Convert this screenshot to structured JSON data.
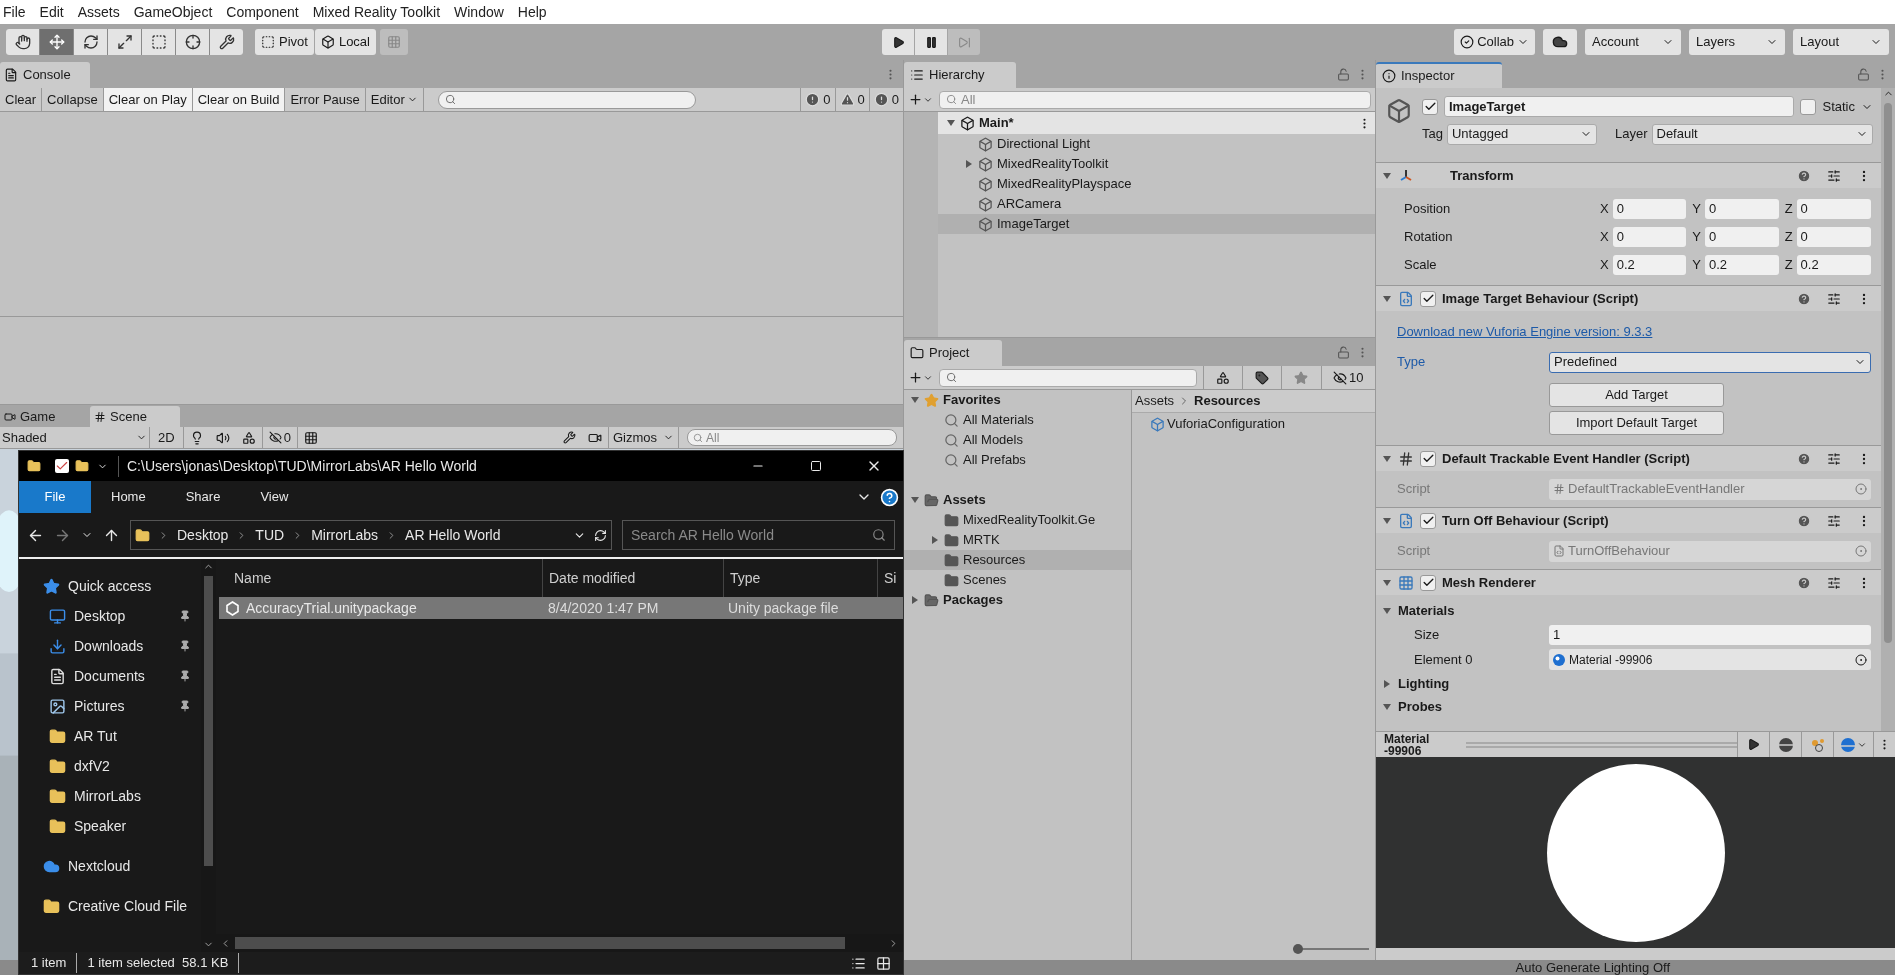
{
  "menu": [
    "File",
    "Edit",
    "Assets",
    "GameObject",
    "Component",
    "Mixed Reality Toolkit",
    "Window",
    "Help"
  ],
  "toolbar": {
    "tools": [
      {
        "selected": false
      },
      {
        "selected": true
      },
      {
        "selected": false
      },
      {
        "selected": false
      },
      {
        "selected": false
      },
      {
        "selected": false
      },
      {
        "selected": false
      }
    ],
    "pivot": "Pivot",
    "local": "Local",
    "collab": "Collab",
    "account": "Account",
    "layers": "Layers",
    "layout": "Layout"
  },
  "console": {
    "tab": "Console",
    "buttons": [
      {
        "label": "Clear",
        "on": false
      },
      {
        "label": "Collapse",
        "on": false
      },
      {
        "label": "Clear on Play",
        "on": true
      },
      {
        "label": "Clear on Build",
        "on": true
      },
      {
        "label": "Error Pause",
        "on": false
      }
    ],
    "editor": "Editor",
    "counts": [
      {
        "kind": "error",
        "count": "0"
      },
      {
        "kind": "warning",
        "count": "0"
      },
      {
        "kind": "info",
        "count": "0"
      }
    ]
  },
  "scene": {
    "tabs": [
      {
        "label": "Game",
        "selected": false
      },
      {
        "label": "Scene",
        "selected": true
      }
    ],
    "shading": "Shaded",
    "mode_2d": "2D",
    "hidden_count": "0",
    "gizmos": "Gizmos",
    "search_placeholder": "All"
  },
  "hierarchy": {
    "tab": "Hierarchy",
    "search_placeholder": "All",
    "scene": "Main*",
    "items": [
      {
        "label": "Directional Light",
        "expandable": false,
        "selected": false
      },
      {
        "label": "MixedRealityToolkit",
        "expandable": true,
        "selected": false
      },
      {
        "label": "MixedRealityPlayspace",
        "expandable": false,
        "selected": false
      },
      {
        "label": "ARCamera",
        "expandable": false,
        "selected": false
      },
      {
        "label": "ImageTarget",
        "expandable": false,
        "selected": true
      }
    ]
  },
  "project": {
    "tab": "Project",
    "hidden_count": "10",
    "tree": [
      {
        "label": "Favorites",
        "kind": "favorites",
        "expanded": true,
        "selected": false,
        "children": [
          {
            "label": "All Materials",
            "kind": "search",
            "selected": false
          },
          {
            "label": "All Models",
            "kind": "search",
            "selected": false
          },
          {
            "label": "All Prefabs",
            "kind": "search",
            "selected": false
          }
        ]
      },
      {
        "label": "Assets",
        "kind": "root",
        "expanded": true,
        "selected": false,
        "children": [
          {
            "label": "MixedRealityToolkit.Ge",
            "kind": "folder",
            "selected": false
          },
          {
            "label": "MRTK",
            "kind": "folder",
            "expanded": false,
            "selected": false
          },
          {
            "label": "Resources",
            "kind": "folder",
            "selected": true
          },
          {
            "label": "Scenes",
            "kind": "folder",
            "selected": false
          }
        ]
      },
      {
        "label": "Packages",
        "kind": "root",
        "expanded": false,
        "selected": false
      }
    ],
    "breadcrumb": [
      "Assets",
      "Resources"
    ],
    "files": [
      "VuforiaConfiguration"
    ],
    "zoom": {
      "level": 0
    }
  },
  "inspector": {
    "tab": "Inspector",
    "active": true,
    "name": "ImageTarget",
    "static": false,
    "static_label": "Static",
    "tag_label": "Tag",
    "tag": "Untagged",
    "layer_label": "Layer",
    "layer": "Default",
    "components": [
      {
        "kind": "transform",
        "title": "Transform",
        "expanded": true,
        "rows": [
          {
            "label": "Position",
            "fields": [
              {
                "axis": "X",
                "value": "0"
              },
              {
                "axis": "Y",
                "value": "0"
              },
              {
                "axis": "Z",
                "value": "0"
              }
            ]
          },
          {
            "label": "Rotation",
            "fields": [
              {
                "axis": "X",
                "value": "0"
              },
              {
                "axis": "Y",
                "value": "0"
              },
              {
                "axis": "Z",
                "value": "0"
              }
            ]
          },
          {
            "label": "Scale",
            "fields": [
              {
                "axis": "X",
                "value": "0.2"
              },
              {
                "axis": "Y",
                "value": "0.2"
              },
              {
                "axis": "Z",
                "value": "0.2"
              }
            ]
          }
        ]
      },
      {
        "kind": "image_target",
        "title": "Image Target Behaviour (Script)",
        "expanded": true,
        "enabled": true,
        "link": "Download new Vuforia Engine version: 9.3.3",
        "type_label": "Type",
        "type_value": "Predefined",
        "buttons": [
          "Add Target",
          "Import Default Target"
        ]
      },
      {
        "kind": "handler",
        "title": "Default Trackable Event Handler (Script)",
        "expanded": true,
        "enabled": true,
        "script_label": "Script",
        "script": "DefaultTrackableEventHandler"
      },
      {
        "kind": "behaviour",
        "title": "Turn Off Behaviour (Script)",
        "expanded": true,
        "enabled": true,
        "script_label": "Script",
        "script": "TurnOffBehaviour"
      },
      {
        "kind": "mesh_renderer",
        "title": "Mesh Renderer",
        "expanded": true,
        "enabled": true,
        "sections": [
          {
            "label": "Materials",
            "expanded": true,
            "fields": [
              {
                "kind": "number",
                "label": "Size",
                "value": "1"
              },
              {
                "kind": "object",
                "label": "Element 0",
                "value": "Material -99906"
              }
            ]
          },
          {
            "label": "Lighting",
            "expanded": false
          },
          {
            "label": "Probes",
            "expanded": true
          }
        ]
      }
    ],
    "preview_title": "Material -99906"
  },
  "explorer": {
    "title": "C:\\Users\\jonas\\Desktop\\TUD\\MirrorLabs\\AR Hello World",
    "ribbon": [
      {
        "label": "File",
        "selected": true
      },
      {
        "label": "Home",
        "selected": false
      },
      {
        "label": "Share",
        "selected": false
      },
      {
        "label": "View",
        "selected": false
      }
    ],
    "breadcrumb": [
      "Desktop",
      "TUD",
      "MirrorLabs",
      "AR Hello World"
    ],
    "search_placeholder": "Search AR Hello World",
    "nav": [
      {
        "label": "Quick access",
        "kind": "quick",
        "pinned": false
      },
      {
        "label": "Desktop",
        "kind": "desktop",
        "pinned": true
      },
      {
        "label": "Downloads",
        "kind": "downloads",
        "pinned": true
      },
      {
        "label": "Documents",
        "kind": "documents",
        "pinned": true
      },
      {
        "label": "Pictures",
        "kind": "pictures",
        "pinned": true
      },
      {
        "label": "AR Tut",
        "kind": "folder",
        "pinned": false
      },
      {
        "label": "dxfV2",
        "kind": "folder",
        "pinned": false
      },
      {
        "label": "MirrorLabs",
        "kind": "folder",
        "pinned": false
      },
      {
        "label": "Speaker",
        "kind": "folder",
        "pinned": false
      },
      {
        "label": "Nextcloud",
        "kind": "cloud",
        "pinned": false
      },
      {
        "label": "Creative Cloud File",
        "kind": "creative",
        "pinned": false
      }
    ],
    "columns": [
      "Name",
      "Date modified",
      "Type",
      "Si"
    ],
    "files": [
      {
        "name": "AccuracyTrial.unitypackage",
        "date": "8/4/2020 1:47 PM",
        "type": "Unity package file",
        "selected": true
      }
    ],
    "status": [
      "1 item",
      "1 item selected  58.1 KB"
    ]
  },
  "status_bar": "Auto Generate Lighting Off"
}
